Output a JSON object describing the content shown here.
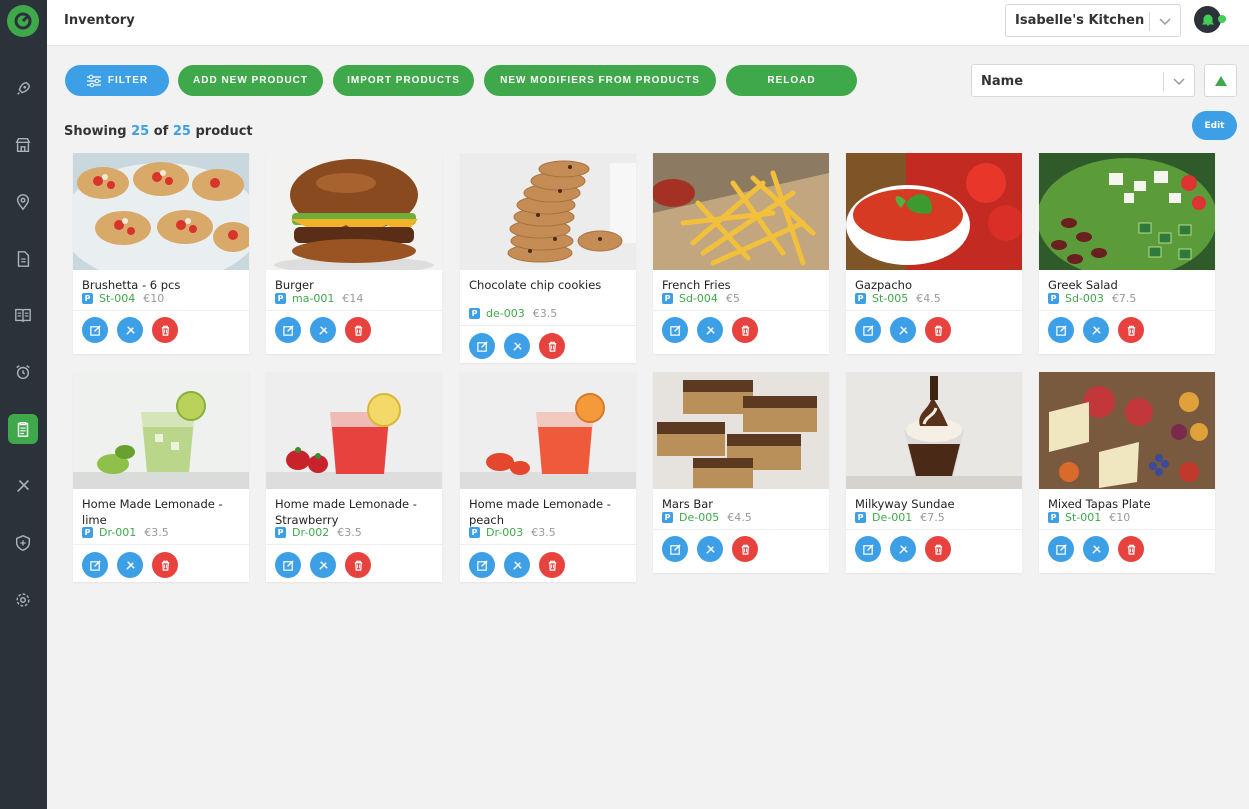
{
  "header": {
    "title": "Inventory",
    "kitchen": "Isabelle's Kitchen"
  },
  "sidebar": {
    "items": [
      {
        "icon": "rocket-icon"
      },
      {
        "icon": "store-icon"
      },
      {
        "icon": "location-pin-icon"
      },
      {
        "icon": "document-icon"
      },
      {
        "icon": "menu-book-icon"
      },
      {
        "icon": "alarm-clock-icon"
      },
      {
        "icon": "clipboard-icon",
        "active": true
      },
      {
        "icon": "cutlery-icon"
      },
      {
        "icon": "shield-icon"
      },
      {
        "icon": "gear-icon"
      }
    ]
  },
  "toolbar": {
    "filter_label": "Filter",
    "add_label": "Add new product",
    "import_label": "Import products",
    "modifiers_label": "New modifiers from products",
    "reload_label": "Reload",
    "sort_value": "Name"
  },
  "summary": {
    "prefix": "Showing",
    "shown": "25",
    "of": "of",
    "total": "25",
    "suffix": "product"
  },
  "edit_label": "Edit",
  "products": [
    {
      "name": "Brushetta - 6 pcs",
      "badge": "P",
      "code": "St-004",
      "price": "€10"
    },
    {
      "name": "Burger",
      "badge": "P",
      "code": "ma-001",
      "price": "€14"
    },
    {
      "name": "Chocolate chip cookies",
      "badge": "P",
      "code": "de-003",
      "price": "€3.5"
    },
    {
      "name": "French Fries",
      "badge": "P",
      "code": "Sd-004",
      "price": "€5"
    },
    {
      "name": "Gazpacho",
      "badge": "P",
      "code": "St-005",
      "price": "€4.5"
    },
    {
      "name": "Greek Salad",
      "badge": "P",
      "code": "Sd-003",
      "price": "€7.5"
    },
    {
      "name": "Home Made Lemonade - lime",
      "badge": "P",
      "code": "Dr-001",
      "price": "€3.5"
    },
    {
      "name": "Home made Lemonade - Strawberry",
      "badge": "P",
      "code": "Dr-002",
      "price": "€3.5"
    },
    {
      "name": "Home made Lemonade - peach",
      "badge": "P",
      "code": "Dr-003",
      "price": "€3.5"
    },
    {
      "name": "Mars Bar",
      "badge": "P",
      "code": "De-005",
      "price": "€4.5"
    },
    {
      "name": "Milkyway Sundae",
      "badge": "P",
      "code": "De-001",
      "price": "€7.5"
    },
    {
      "name": "Mixed Tapas Plate",
      "badge": "P",
      "code": "St-001",
      "price": "€10"
    }
  ],
  "colors": {
    "sidebar": "#2b323a",
    "green": "#3fa84a",
    "blue": "#3d9fe5",
    "red": "#e8423f"
  }
}
